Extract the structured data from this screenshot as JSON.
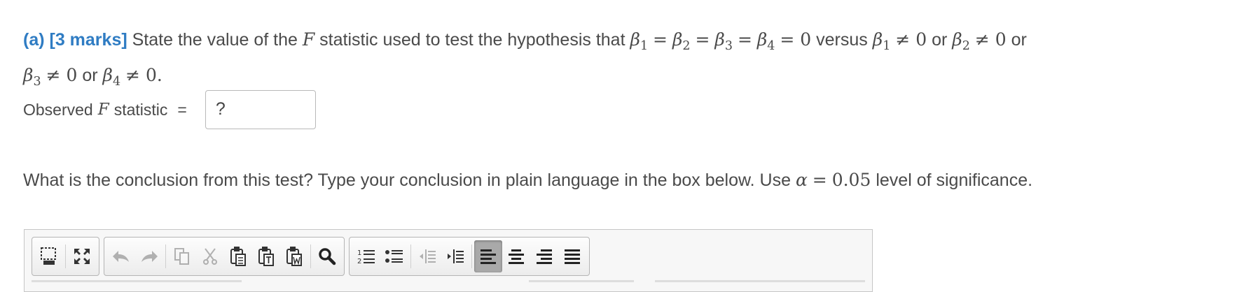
{
  "question_a": {
    "label": "(a) [3 marks]",
    "text_1": "State the value of the",
    "F": "F",
    "text_2": "statistic used to test the hypothesis that",
    "hyp_null": "β₁ = β₂ = β₃ = β₄ = 0",
    "versus": "versus",
    "or": "or",
    "ne0": "≠ 0",
    "zero": "= 0",
    "eq": "=",
    "beta": "β",
    "period": "."
  },
  "observed": {
    "label": "Observed",
    "F": "F",
    "suffix": "statistic",
    "equals": "=",
    "value": "?"
  },
  "question_b": {
    "text_1": "What is the conclusion from this test? Type your conclusion in plain language in the box below. Use",
    "alpha": "α",
    "equals": "=",
    "alpha_value": "0.05",
    "text_2": "level of significance."
  },
  "toolbar": {
    "groups": [
      [
        "show-blocks-icon",
        "maximize-icon"
      ],
      [
        "undo-icon",
        "redo-icon",
        "copy-icon",
        "cut-icon",
        "paste-icon",
        "paste-text-icon",
        "paste-word-icon",
        "find-icon"
      ],
      [
        "numbered-list-icon",
        "bulleted-list-icon",
        "outdent-icon",
        "indent-icon",
        "align-left-icon",
        "align-center-icon",
        "align-right-icon",
        "justify-icon"
      ]
    ],
    "active": "align-left-icon"
  }
}
